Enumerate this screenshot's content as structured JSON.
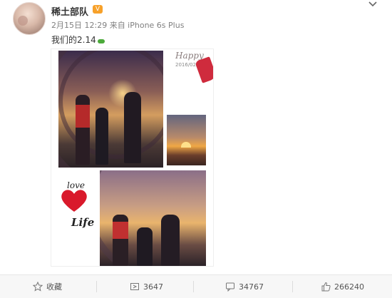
{
  "post": {
    "username": "稀土部队",
    "badge": "V",
    "meta": "2月15日 12:29 来自 iPhone 6s Plus",
    "text": "我们的2.14"
  },
  "collage": {
    "happy_text": "Happy",
    "happy_date": "2016/02",
    "love_text": "love",
    "life_text": "Life"
  },
  "actions": {
    "favorite_label": "收藏",
    "repost_count": "3647",
    "comment_count": "34767",
    "like_count": "266240"
  },
  "colors": {
    "heart": "#d9192b",
    "action_bar": "#f7f7f7"
  }
}
